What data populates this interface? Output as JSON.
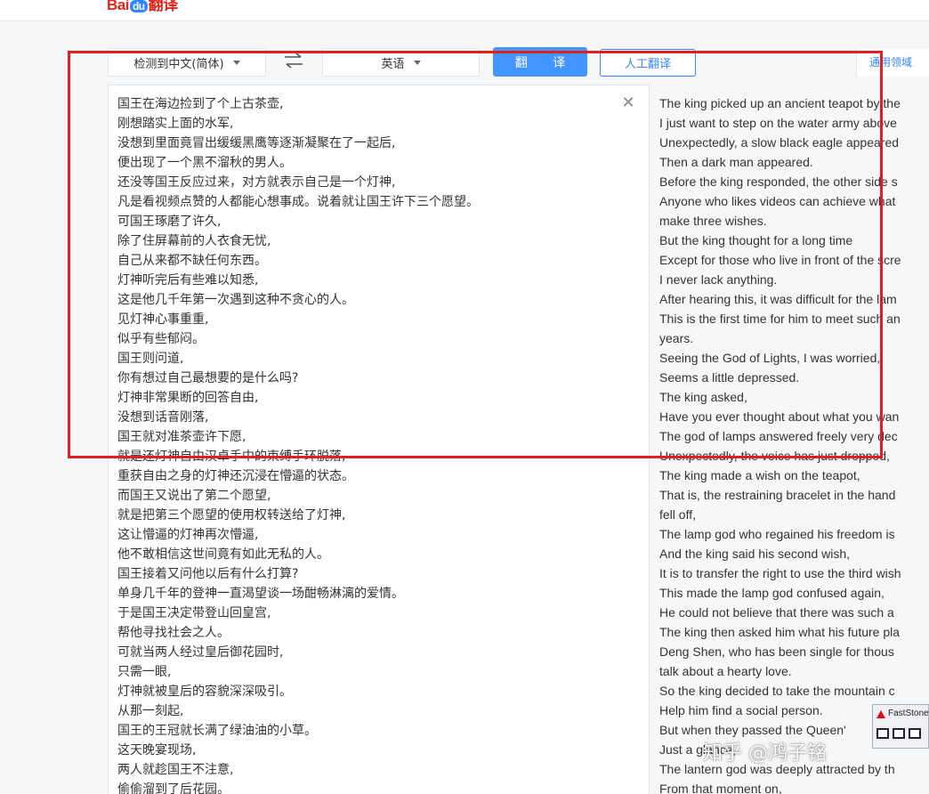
{
  "header": {
    "logo_text": "Bai",
    "logo_mark": "du",
    "logo_suffix": "翻译"
  },
  "toolbar": {
    "source_language": "检测到中文(简体)",
    "target_language": "英语",
    "swap_icon": "swap-arrows-icon",
    "translate_label": "翻 译",
    "human_translate_label": "人工翻译",
    "domain_label": "通用领域"
  },
  "source": {
    "close_glyph": "✕",
    "lines": [
      "国王在海边捡到了个上古茶壶,",
      "刚想踏实上面的水军,",
      "没想到里面竟冒出缓缓黑鹰等逐渐凝聚在了一起后,",
      "便出现了一个黑不溜秋的男人。",
      "还没等国王反应过来，对方就表示自己是一个灯神,",
      "凡是看视频点赞的人都能心想事成。说着就让国王许下三个愿望。",
      "可国王琢磨了许久,",
      "除了住屏幕前的人衣食无忧,",
      "自己从来都不缺任何东西。",
      "灯神听完后有些难以知悉,",
      "这是他几千年第一次遇到这种不贪心的人。",
      "见灯神心事重重,",
      "似乎有些郁闷。",
      "国王则问道,",
      "你有想过自己最想要的是什么吗?",
      "灯神非常果断的回答自由,",
      "没想到话音刚落,",
      "国王就对准茶壶许下愿,",
      "就是还灯神自由汉卓手中的束缚手环脱落,",
      "重获自由之身的灯神还沉浸在懵逼的状态。",
      "而国王又说出了第二个愿望,",
      "就是把第三个愿望的使用权转送给了灯神,",
      "这让懵逼的灯神再次懵逼,",
      "他不敢相信这世间竟有如此无私的人。",
      "国王接着又问他以后有什么打算?",
      "单身几千年的登神一直渴望谈一场酣畅淋漓的爱情。",
      "于是国王决定带登山回皇宫,",
      "帮他寻找社会之人。",
      "可就当两人经过皇后御花园时,",
      "只需一眼,",
      "灯神就被皇后的容貌深深吸引。",
      "从那一刻起,",
      "国王的王冠就长满了绿油油的小草。",
      "这天晚宴现场,",
      "两人就趁国王不注意,",
      "偷偷溜到了后花园。"
    ]
  },
  "target": {
    "lines": [
      "The king picked up an ancient teapot by the",
      "I just want to step on the water army above",
      "Unexpectedly, a slow black eagle appeared",
      "Then a dark man appeared.",
      "Before the king responded, the other side s",
      "Anyone who likes videos can achieve what",
      "make three wishes.",
      "But the king thought for a long time",
      "Except for those who live in front of the scre",
      "I never lack anything.",
      "After hearing this, it was difficult for the lam",
      "This is the first time for him to meet such an",
      "years.",
      "Seeing the God of Lights, I was worried,",
      "Seems a little depressed.",
      "The king asked,",
      "Have you ever thought about what you wan",
      "The god of lamps answered freely very dec",
      "Unexpectedly, the voice has just dropped,",
      "The king made a wish on the teapot,",
      "That is, the restraining bracelet in the hand",
      "fell off,",
      "The lamp god who regained his freedom is",
      "And the king said his second wish,",
      "It is to transfer the right to use the third wish",
      "This made the lamp god confused again,",
      "He could not believe that there was such a",
      "The king then asked him what his future pla",
      "Deng Shen, who has been single for thous",
      "talk about a hearty love.",
      "So the king decided to take the mountain c",
      "Help him find a social person.",
      "But when they passed the Queen'",
      "Just a glance,",
      "The lantern god was deeply attracted by th",
      "From that moment on,"
    ]
  },
  "overlay": {
    "faststone_title": "FastStone",
    "watermark": "知乎 @鸿子铭"
  },
  "colors": {
    "accent": "#4395ff",
    "link": "#3385ff",
    "annotation": "#e02020"
  }
}
